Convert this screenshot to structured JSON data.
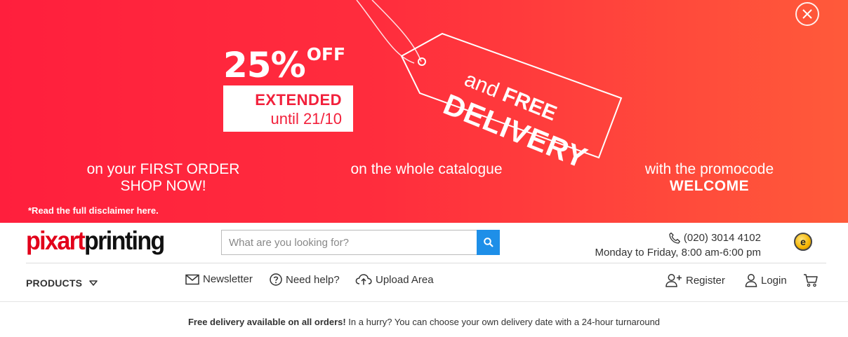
{
  "banner": {
    "discount_pct": "25%",
    "discount_word": "OFF",
    "extended_label": "EXTENDED",
    "until_label": "until 21/10",
    "tag_and": "and",
    "tag_free": "FREE",
    "tag_delivery": "DELIVERY",
    "col1_line1": "on your FIRST ORDER",
    "col1_line2": "SHOP NOW!",
    "col2": "on the whole catalogue",
    "col3_line1": "with the promocode",
    "col3_code": "WELCOME",
    "disclaimer": "*Read the full disclaimer here.",
    "close_icon": "close-icon"
  },
  "header": {
    "logo_part1": "pixart",
    "logo_part2": "printing",
    "search_placeholder": "What are you looking for?",
    "phone": "(020) 3014 4102",
    "hours": "Monday to Friday, 8:00 am-6:00 pm",
    "trust_badge": "e"
  },
  "nav": {
    "products": "PRODUCTS",
    "newsletter": "Newsletter",
    "help": "Need help?",
    "upload": "Upload Area",
    "register": "Register",
    "login": "Login"
  },
  "notice": {
    "bold": "Free delivery available on all orders!",
    "rest": " In a hurry? You can choose your own delivery date with a 24-hour turnaround"
  },
  "colors": {
    "banner_start": "#ff1f3d",
    "banner_end": "#ff5a3a",
    "logo_red": "#e2001a",
    "search_button": "#1e8fe8"
  }
}
